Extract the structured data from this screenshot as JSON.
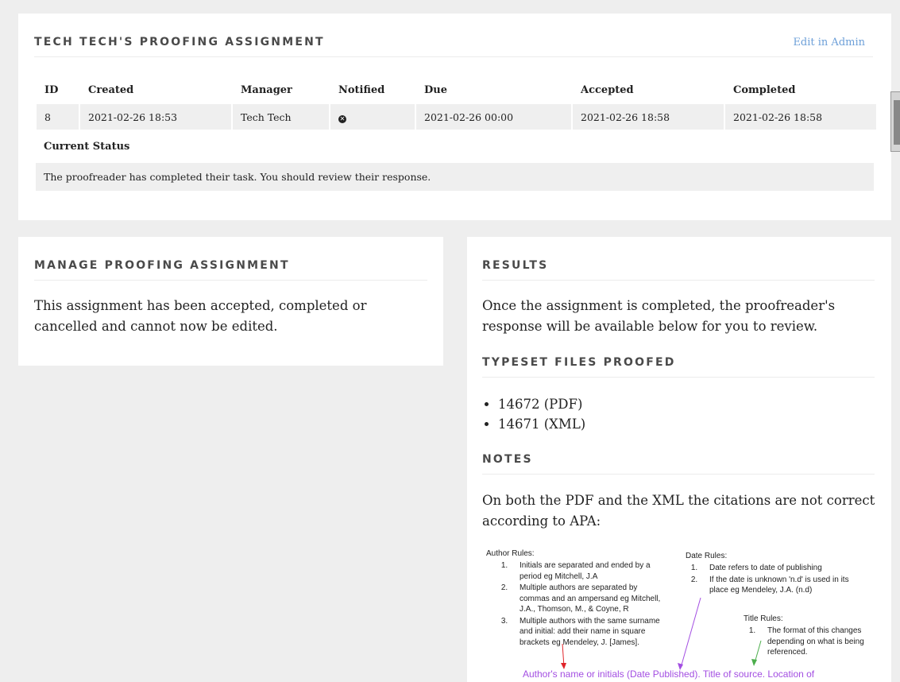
{
  "assignment": {
    "title": "TECH TECH'S PROOFING ASSIGNMENT",
    "edit_link": "Edit in Admin",
    "columns": [
      "ID",
      "Created",
      "Manager",
      "Notified",
      "Due",
      "Accepted",
      "Completed"
    ],
    "row": {
      "id": "8",
      "created": "2021-02-26 18:53",
      "manager": "Tech Tech",
      "notified_icon": "times-circle-icon",
      "due": "2021-02-26 00:00",
      "accepted": "2021-02-26 18:58",
      "completed": "2021-02-26 18:58"
    },
    "status_label": "Current Status",
    "status_text": "The proofreader has completed their task. You should review their response."
  },
  "manage": {
    "title": "MANAGE PROOFING ASSIGNMENT",
    "text": "This assignment has been accepted, completed or cancelled and cannot now be edited."
  },
  "results": {
    "title": "RESULTS",
    "text": "Once the assignment is completed, the proofreader's response will be available below for you to review.",
    "files_title": "TYPESET FILES PROOFED",
    "files": [
      "14672 (PDF)",
      "14671 (XML)"
    ],
    "notes_title": "NOTES",
    "notes_text": "On both the PDF and the XML the citations are not correct according to APA:",
    "figure": {
      "author_title": "Author Rules:",
      "author_rules": [
        "Initials are separated and ended by a period eg Mitchell, J.A",
        "Multiple authors are separated by commas and an ampersand eg Mitchell, J.A., Thomson, M., & Coyne, R",
        "Multiple authors with the same surname and initial: add their name in square brackets eg Mendeley, J. [James]."
      ],
      "date_title": "Date Rules:",
      "date_rules": [
        "Date refers to date of publishing",
        "If the date is unknown 'n.d' is used in its place eg Mendeley, J.A. (n.d)"
      ],
      "title_title": "Title Rules:",
      "title_rules": [
        "The format of this changes depending on what is being referenced."
      ],
      "bottom_line": "Author's name or initials (Date Published). Title of source. Location of"
    }
  },
  "colors": {
    "background": "#eeeeee",
    "link": "#6c9fd8",
    "arrow_red": "#e0242a",
    "arrow_purple": "#a34ee2",
    "arrow_green": "#4cae4c"
  }
}
